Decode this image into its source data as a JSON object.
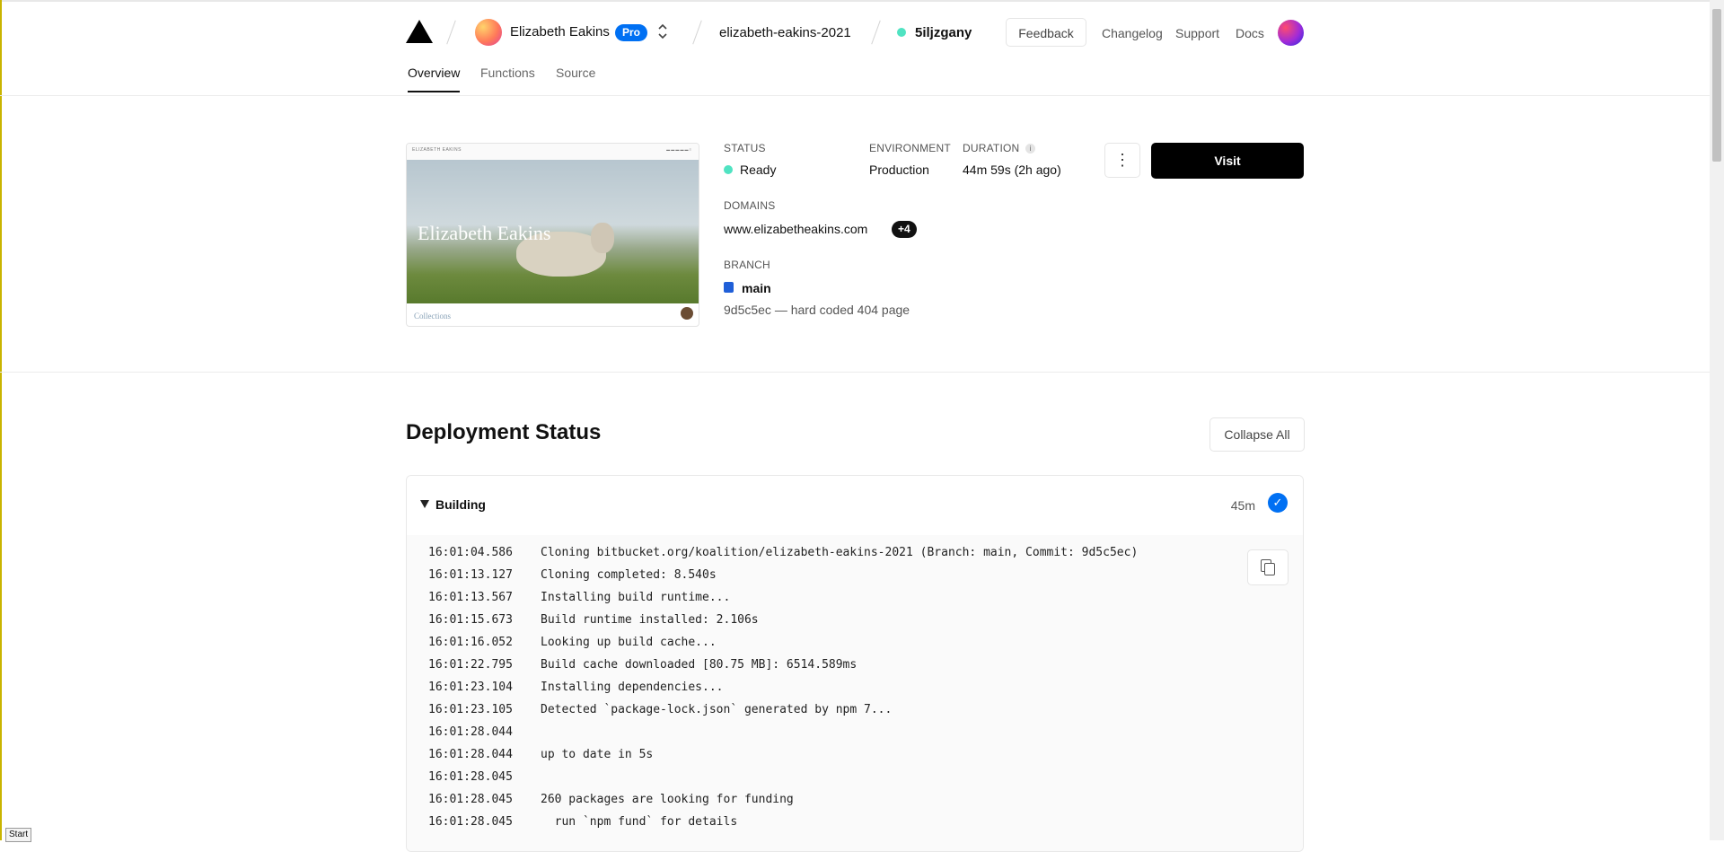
{
  "header": {
    "team_name": "Elizabeth Eakins",
    "plan_badge": "Pro",
    "project_name": "elizabeth-eakins-2021",
    "deployment_id": "5iljzgany",
    "feedback_label": "Feedback",
    "links": [
      "Changelog",
      "Support",
      "Docs"
    ],
    "tabs": [
      "Overview",
      "Functions",
      "Source"
    ]
  },
  "overview": {
    "preview": {
      "site_nav_text": "ELIZABETH EAKINS",
      "hero_title": "Elizabeth Eakins",
      "footer_text": "Collections"
    },
    "status_label": "STATUS",
    "status_value": "Ready",
    "status_color": "#50e3c2",
    "environment_label": "ENVIRONMENT",
    "environment_value": "Production",
    "duration_label": "DURATION",
    "duration_value": "44m 59s  (2h ago)",
    "domains_label": "DOMAINS",
    "domain_value": "www.elizabetheakins.com",
    "domains_extra": "+4",
    "branch_label": "BRANCH",
    "branch_value": "main",
    "commit_value": "9d5c5ec — hard coded 404 page",
    "visit_label": "Visit",
    "more_icon": "⋮"
  },
  "deployment": {
    "title": "Deployment Status",
    "collapse_label": "Collapse All",
    "build": {
      "label": "Building",
      "time": "45m",
      "logs": [
        {
          "time": "16:01:04.586",
          "msg": "Cloning bitbucket.org/koalition/elizabeth-eakins-2021 (Branch: main, Commit: 9d5c5ec)"
        },
        {
          "time": "16:01:13.127",
          "msg": "Cloning completed: 8.540s"
        },
        {
          "time": "16:01:13.567",
          "msg": "Installing build runtime..."
        },
        {
          "time": "16:01:15.673",
          "msg": "Build runtime installed: 2.106s"
        },
        {
          "time": "16:01:16.052",
          "msg": "Looking up build cache..."
        },
        {
          "time": "16:01:22.795",
          "msg": "Build cache downloaded [80.75 MB]: 6514.589ms"
        },
        {
          "time": "16:01:23.104",
          "msg": "Installing dependencies..."
        },
        {
          "time": "16:01:23.105",
          "msg": "Detected `package-lock.json` generated by npm 7..."
        },
        {
          "time": "16:01:28.044",
          "msg": ""
        },
        {
          "time": "16:01:28.044",
          "msg": "up to date in 5s"
        },
        {
          "time": "16:01:28.045",
          "msg": ""
        },
        {
          "time": "16:01:28.045",
          "msg": "260 packages are looking for funding"
        },
        {
          "time": "16:01:28.045",
          "msg": "  run `npm fund` for details"
        }
      ]
    }
  },
  "taskbar": {
    "start_label": "Start"
  }
}
